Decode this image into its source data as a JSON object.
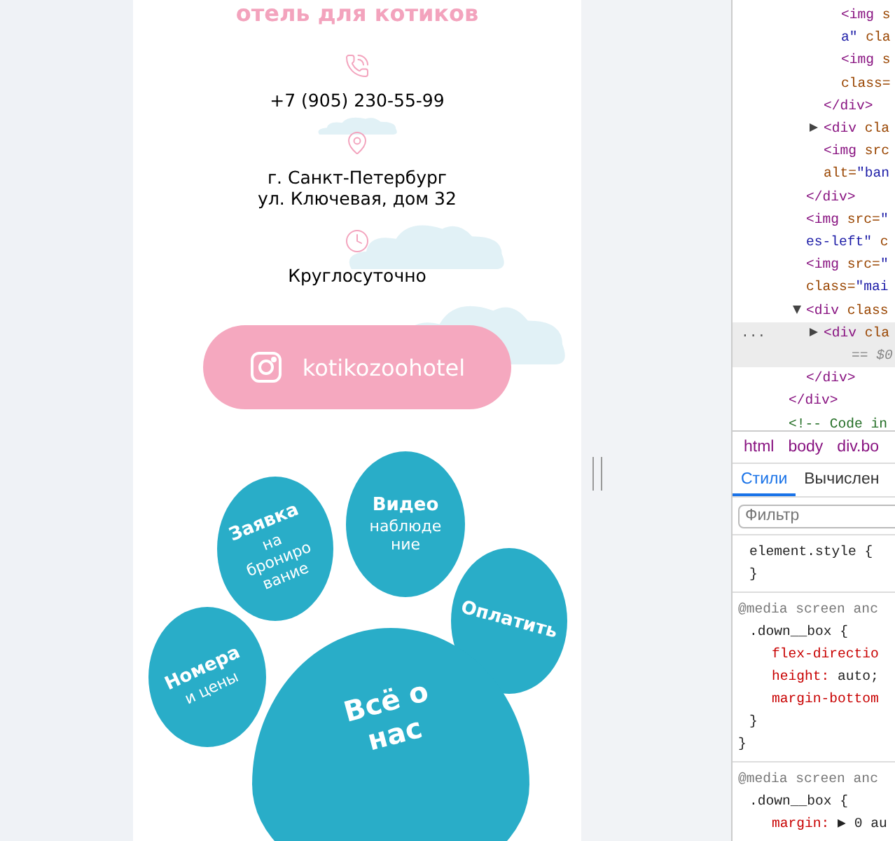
{
  "page": {
    "title": "отель для котиков",
    "contacts": [
      {
        "kind": "phone",
        "lines": [
          "+7 (905) 230-55-99"
        ]
      },
      {
        "kind": "address",
        "lines": [
          "г. Санкт-Петербург",
          "ул. Ключевая, дом 32"
        ]
      },
      {
        "kind": "hours",
        "lines": [
          "Круглосуточно"
        ]
      }
    ],
    "instagram_button": {
      "label": "kotikozoohotel"
    },
    "paw_buttons": [
      {
        "kind": "toe",
        "title": "Заявка",
        "subtitle": [
          "на",
          "брониро",
          "вание"
        ]
      },
      {
        "kind": "toe",
        "title": "Видео",
        "subtitle": [
          "наблюде",
          "ние"
        ]
      },
      {
        "kind": "toe",
        "title": "Оплатить"
      },
      {
        "kind": "toe",
        "title": "Номера",
        "subtitle": [
          "и цены"
        ]
      },
      {
        "kind": "pad",
        "title": "Всё о",
        "subtitle": [
          "нас"
        ]
      }
    ]
  },
  "devtools": {
    "dom_tree": [
      {
        "children": [
          {
            "children": [
              {
                "children": [
                  {
                    "selected": false,
                    "lines": [
                      [
                        {
                          "kind": "tag",
                          "text": "<img"
                        },
                        {
                          "kind": "attr",
                          "text": " s"
                        }
                      ],
                      [
                        {
                          "kind": "string",
                          "text": "a\""
                        },
                        {
                          "kind": "attr",
                          "text": " cla"
                        }
                      ]
                    ]
                  },
                  {
                    "selected": false,
                    "lines": [
                      [
                        {
                          "kind": "tag",
                          "text": "<img"
                        },
                        {
                          "kind": "attr",
                          "text": " s"
                        }
                      ],
                      [
                        {
                          "kind": "attr",
                          "text": "class="
                        }
                      ]
                    ]
                  }
                ]
              },
              {
                "selected": false,
                "lines": [
                  [
                    {
                      "kind": "tag",
                      "text": "</div>"
                    }
                  ]
                ]
              },
              {
                "selected": false,
                "expanded": false,
                "lines": [
                  [
                    {
                      "kind": "tag",
                      "text": "<div"
                    },
                    {
                      "kind": "attr",
                      "text": " cla"
                    }
                  ]
                ]
              },
              {
                "selected": false,
                "lines": [
                  [
                    {
                      "kind": "tag",
                      "text": "<img"
                    },
                    {
                      "kind": "attr",
                      "text": " src"
                    }
                  ],
                  [
                    {
                      "kind": "attr",
                      "text": "alt="
                    },
                    {
                      "kind": "string",
                      "text": "\"ban"
                    }
                  ]
                ]
              }
            ]
          },
          {
            "selected": false,
            "lines": [
              [
                {
                  "kind": "tag",
                  "text": "</div>"
                }
              ]
            ]
          },
          {
            "selected": false,
            "lines": [
              [
                {
                  "kind": "tag",
                  "text": "<img"
                },
                {
                  "kind": "attr",
                  "text": " src="
                },
                {
                  "kind": "string",
                  "text": "\""
                }
              ],
              [
                {
                  "kind": "string",
                  "text": "es-left\""
                },
                {
                  "kind": "attr",
                  "text": " c"
                }
              ]
            ]
          },
          {
            "selected": false,
            "lines": [
              [
                {
                  "kind": "tag",
                  "text": "<img"
                },
                {
                  "kind": "attr",
                  "text": " src="
                },
                {
                  "kind": "string",
                  "text": "\""
                }
              ],
              [
                {
                  "kind": "attr",
                  "text": "class="
                },
                {
                  "kind": "string",
                  "text": "\"mai"
                }
              ]
            ]
          },
          {
            "selected": false,
            "expanded": true,
            "lines": [
              [
                {
                  "kind": "tag",
                  "text": "<div"
                },
                {
                  "kind": "attr",
                  "text": " class"
                }
              ]
            ],
            "children": [
              {
                "selected": true,
                "expanded": false,
                "more": "...",
                "suffix": "== $0",
                "lines": [
                  [
                    {
                      "kind": "tag",
                      "text": "<div"
                    },
                    {
                      "kind": "attr",
                      "text": " cla"
                    }
                  ]
                ]
              }
            ]
          },
          {
            "selected": false,
            "lines": [
              [
                {
                  "kind": "tag",
                  "text": "</div>"
                }
              ]
            ]
          }
        ]
      },
      {
        "selected": false,
        "lines": [
          [
            {
              "kind": "tag",
              "text": "</div>"
            }
          ]
        ]
      },
      {
        "selected": false,
        "lines": [
          [
            {
              "kind": "comment",
              "text": "<!-- Code in"
            }
          ]
        ]
      }
    ],
    "breadcrumbs": [
      "html",
      "body",
      "div.bo"
    ],
    "tabs": [
      {
        "label": "Стили",
        "selected": true
      },
      {
        "label": "Вычислен",
        "selected": false
      }
    ],
    "filter": {
      "placeholder": "Фильтр"
    },
    "rules": [
      {
        "lines": [
          {
            "kind": "selector",
            "text": "element.style {"
          },
          {
            "kind": "close",
            "text": "}"
          }
        ]
      },
      {
        "lines": [
          {
            "kind": "at",
            "text": "@media screen anc"
          },
          {
            "kind": "selector",
            "text": ".down__box {"
          },
          {
            "kind": "prop",
            "text": "flex-directio"
          },
          {
            "kind": "prop",
            "text": "height:",
            "value": " auto;"
          },
          {
            "kind": "prop",
            "text": "margin-bottom"
          },
          {
            "kind": "close",
            "text": "}"
          },
          {
            "kind": "outer",
            "text": "}"
          }
        ]
      },
      {
        "lines": [
          {
            "kind": "at",
            "text": "@media screen anc"
          },
          {
            "kind": "selector",
            "text": ".down__box {"
          },
          {
            "kind": "prop",
            "text": "margin:",
            "value": " ▶ 0 au"
          }
        ]
      }
    ]
  }
}
